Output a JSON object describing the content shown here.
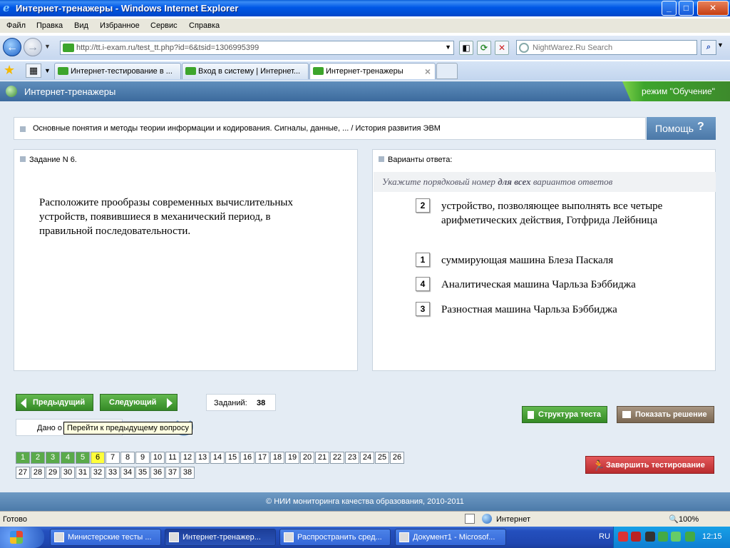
{
  "window": {
    "title": "Интернет-тренажеры - Windows Internet Explorer",
    "min": "_",
    "max": "□",
    "close": "✕"
  },
  "menu": [
    "Файл",
    "Правка",
    "Вид",
    "Избранное",
    "Сервис",
    "Справка"
  ],
  "address": {
    "url": "http://tt.i-exam.ru/test_tt.php?id=6&tsid=1306995399",
    "search_placeholder": "NightWarez.Ru Search"
  },
  "tabs": [
    {
      "label": "Интернет-тестирование в ..."
    },
    {
      "label": "Вход в систему | Интернет..."
    },
    {
      "label": "Интернет-тренажеры"
    }
  ],
  "app": {
    "title": "Интернет-тренажеры",
    "mode": "режим \"Обучение\""
  },
  "breadcrumb": "Основные понятия и методы теории информации и кодирования. Сигналы, данные, ... / История развития ЭВМ",
  "help_label": "Помощь",
  "help_icon": "?",
  "task": {
    "header": "Задание N 6.",
    "text": "Расположите прообразы современных вычислительных устройств, появившиеся в механический период, в правильной последовательности."
  },
  "answers": {
    "header": "Варианты ответа:",
    "hint_pre": "Укажите порядковый номер ",
    "hint_bold": "для всех",
    "hint_post": " вариантов ответов",
    "items": [
      {
        "num": "2",
        "text": "устройство, позволяющее выполнять все четыре арифметических действия, Готфрида Лейбница"
      },
      {
        "num": "1",
        "text": "суммирующая машина Блеза Паскаля"
      },
      {
        "num": "4",
        "text": "Аналитическая машина Чарльза Бэббиджа"
      },
      {
        "num": "3",
        "text": "Разностная машина Чарльза Бэббиджа"
      }
    ]
  },
  "nav": {
    "prev": "Предыдущий",
    "next": "Следующий",
    "count_label": "Заданий:",
    "count_value": "38",
    "given_label": "Дано о",
    "tooltip": "Перейти к предыдущему вопросу"
  },
  "actions": {
    "structure": "Структура теста",
    "solution": "Показать решение",
    "finish": "Завершить тестирование"
  },
  "questions": {
    "numbers": [
      "1",
      "2",
      "3",
      "4",
      "5",
      "6",
      "7",
      "8",
      "9",
      "10",
      "11",
      "12",
      "13",
      "14",
      "15",
      "16",
      "17",
      "18",
      "19",
      "20",
      "21",
      "22",
      "23",
      "24",
      "25",
      "26",
      "27",
      "28",
      "29",
      "30",
      "31",
      "32",
      "33",
      "34",
      "35",
      "36",
      "37",
      "38"
    ],
    "done": [
      "1",
      "2",
      "3",
      "4",
      "5"
    ],
    "current": "6"
  },
  "footer": "© НИИ мониторинга качества образования, 2010-2011",
  "status": {
    "ready": "Готово",
    "zone": "Интернет",
    "zoom": "100%"
  },
  "taskbar": {
    "tasks": [
      {
        "label": "Министерские тесты ..."
      },
      {
        "label": "Интернет-тренажер..."
      },
      {
        "label": "Распространить сред..."
      },
      {
        "label": "Документ1 - Microsof..."
      }
    ],
    "lang": "RU",
    "time": "12:15"
  }
}
